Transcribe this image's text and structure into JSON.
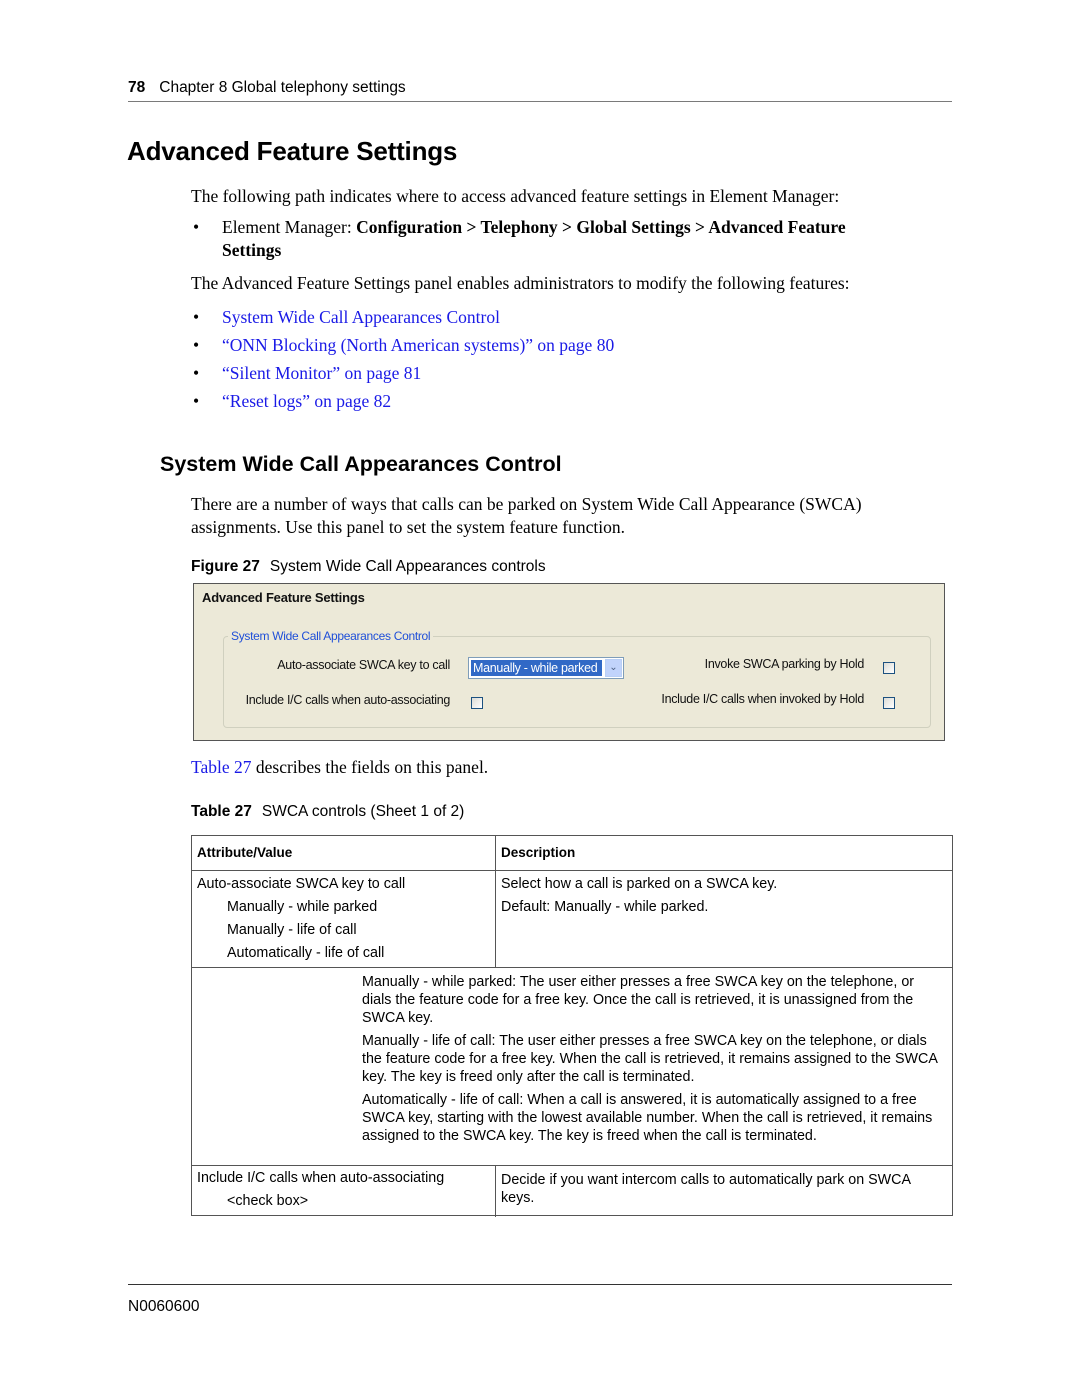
{
  "header": {
    "page_number": "78",
    "chapter": "Chapter 8  Global telephony settings"
  },
  "section": {
    "title": "Advanced Feature Settings",
    "intro": "The following path indicates where to access advanced feature settings in Element Manager:",
    "path_prefix": "Element Manager: ",
    "path_bold_line1": "Configuration > Telephony > Global Settings > Advanced Feature",
    "path_bold_line2": "Settings",
    "features_intro": "The Advanced Feature Settings panel enables administrators to modify the following features:",
    "feature_links": [
      "System Wide Call Appearances Control",
      "“ONN Blocking (North American systems)” on page 80",
      "“Silent Monitor” on page 81",
      "“Reset logs” on page 82"
    ]
  },
  "subsection": {
    "title": "System Wide Call Appearances Control",
    "para_line1": "There are a number of ways that calls can be parked on System Wide Call Appearance (SWCA)",
    "para_line2": "assignments. Use this panel to set the system feature function."
  },
  "figure": {
    "label": "Figure 27",
    "caption": "System Wide Call Appearances controls",
    "panel": {
      "title": "Advanced Feature Settings",
      "group_title": "System Wide Call Appearances Control",
      "auto_associate_label": "Auto-associate SWCA key to call",
      "auto_associate_value": "Manually - while parked",
      "include_ic_auto_label": "Include I/C calls when auto-associating",
      "include_ic_auto_checked": false,
      "invoke_hold_label": "Invoke SWCA parking by Hold",
      "invoke_hold_checked": false,
      "include_ic_hold_label": "Include I/C calls when invoked by Hold",
      "include_ic_hold_checked": false
    }
  },
  "table_ref": {
    "link": "Table 27",
    "text": " describes the fields on this panel."
  },
  "table": {
    "label": "Table 27",
    "caption": "SWCA controls (Sheet 1 of 2)",
    "headers": [
      "Attribute/Value",
      "Description"
    ],
    "row1": {
      "attribute": "Auto-associate SWCA key to call",
      "values": [
        "Manually - while parked",
        "Manually - life of call",
        "Automatically - life of call"
      ],
      "description": [
        "Select how a call is parked on a SWCA key.",
        "Default: Manually - while parked."
      ]
    },
    "notes": [
      "Manually - while parked: The user either presses a free SWCA key on the telephone, or dials the feature code for a free key. Once the call is retrieved, it is unassigned from the SWCA key.",
      "Manually - life of call: The user either presses a free SWCA key on the telephone, or dials the feature code for a free key. When the call is retrieved, it remains assigned to the SWCA key. The key is freed only after the call is terminated.",
      "Automatically - life of call: When a call is answered, it is automatically assigned to a free SWCA key, starting with the lowest available number. When the call is retrieved, it remains assigned to the SWCA key. The key is freed when the call is terminated."
    ],
    "row2": {
      "attribute": "Include I/C calls when auto-associating",
      "value": "<check box>",
      "description": "Decide if you want intercom calls to automatically park on SWCA keys."
    }
  },
  "footer": {
    "doc_number": "N0060600"
  }
}
